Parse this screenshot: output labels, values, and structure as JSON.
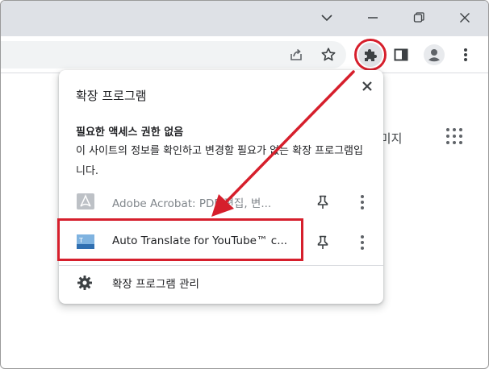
{
  "background": {
    "right_text": "이미지"
  },
  "popup": {
    "title": "확장 프로그램",
    "section_title": "필요한 액세스 권한 없음",
    "section_desc": "이 사이트의 정보를 확인하고 변경할 필요가 없는 확장 프로그램입니다.",
    "extensions": [
      {
        "name": "Adobe Acrobat: PDF 편집, 변...",
        "icon": "acrobat-icon"
      },
      {
        "name": "Auto Translate for YouTube™ c...",
        "icon": "translate-icon"
      }
    ],
    "manage_label": "확장 프로그램 관리"
  },
  "colors": {
    "highlight": "#d61f2c",
    "titlebar": "#dee1e6",
    "omnibox": "#f1f3f4"
  },
  "icons": {
    "titlebar": [
      "chevron-down-icon",
      "minimize-icon",
      "restore-icon",
      "close-icon"
    ],
    "toolbar": [
      "share-icon",
      "star-icon",
      "puzzle-icon",
      "side-panel-icon",
      "profile-icon",
      "more-vert-icon"
    ]
  }
}
